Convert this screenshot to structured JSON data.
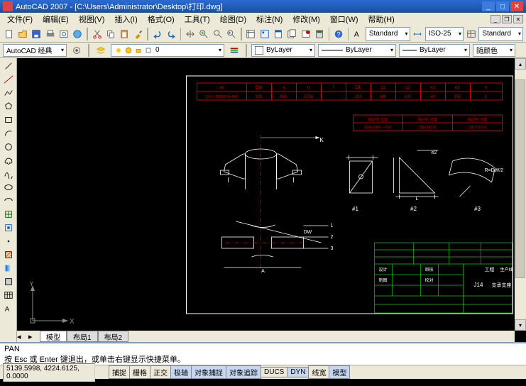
{
  "titlebar": {
    "app": "AutoCAD 2007",
    "doc": "[C:\\Users\\Administrator\\Desktop\\打印.dwg]"
  },
  "menu": {
    "file": "文件(F)",
    "edit": "编辑(E)",
    "view": "视图(V)",
    "insert": "插入(I)",
    "format": "格式(O)",
    "tools": "工具(T)",
    "draw": "绘图(D)",
    "dimension": "标注(N)",
    "modify": "修改(M)",
    "window": "窗口(W)",
    "help": "帮助(H)"
  },
  "toolbar2": {
    "textStyle": "Standard",
    "dimStyle": "ISO-25",
    "tableStyle": "Standard"
  },
  "workspace": {
    "name": "AutoCAD 经典",
    "layer": "0",
    "linetype": "ByLayer",
    "lineweight": "ByLayer",
    "color": "随颜色"
  },
  "tabs": {
    "model": "模型",
    "layout1": "布局1",
    "layout2": "布局2"
  },
  "cmd": {
    "l1": "PAN",
    "l2": "按 Esc 或 Enter 键退出，或单击右键显示快捷菜单。"
  },
  "status": {
    "coords": "5139.5998, 4224.6125, 0.0000",
    "snap": "捕捉",
    "grid": "栅格",
    "ortho": "正交",
    "polar": "极轴",
    "osnap": "对象捕捉",
    "otrack": "对象追踪",
    "ducs": "DUCS",
    "dyn": "DYN",
    "lwt": "线宽",
    "model": "模型"
  },
  "drawing": {
    "ucsX": "X",
    "ucsY": "Y",
    "tableSpec": "J14-1 DN500 A=840",
    "th1": "a#",
    "th2": "DW",
    "th3": "a",
    "th4": "b",
    "th5": "l",
    "th6": "D1",
    "th7": "c1",
    "th8": "c2",
    "th9": "e1",
    "th10": "e2",
    "th11": "n",
    "tv1": "325",
    "tv2": "668",
    "tv3": "270a",
    "tv4": "",
    "tv5": "203",
    "tv6": "160",
    "tv7": "100",
    "tv8": "40",
    "tv9": "255",
    "tv10": "88",
    "tv11": "2",
    "plate1h": "板(2件) 双面",
    "plate2h": "板(4件) 双面",
    "plate3h": "板(2件) 双面",
    "plate1v": "804×204×—×5.0",
    "plate2v": "290×160×6",
    "plate3v": "320×210×8",
    "dimK": "K",
    "dimA": "A",
    "dimE2": "e2",
    "dimL": "L",
    "dimR": "R=DW/2",
    "dimDW": "DW",
    "dim1": "1",
    "dim2": "2",
    "dim3": "3",
    "view1": "#1",
    "view2": "#2",
    "view3": "#3",
    "tb_proj": "工程",
    "tb_projv": "生产线",
    "tb_num": "J14",
    "tb_name": "支承支座",
    "tb_c1": "设计",
    "tb_c2": "制图",
    "tb_c3": "审核",
    "tb_c4": "校对"
  }
}
